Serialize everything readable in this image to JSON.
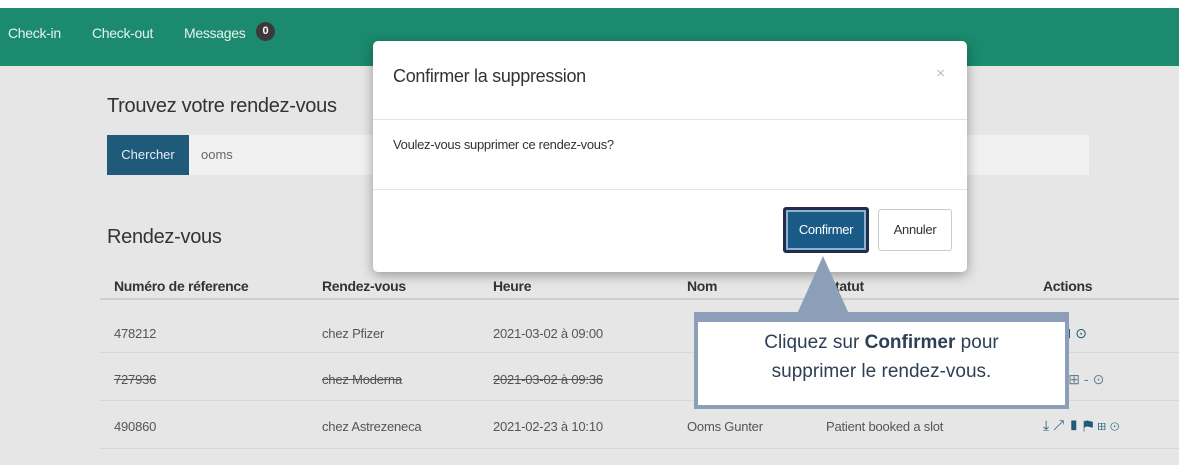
{
  "nav": {
    "checkin": "Check-in",
    "checkout": "Check-out",
    "messages": "Messages",
    "messages_count": "0"
  },
  "search": {
    "title": "Trouvez votre rendez-vous",
    "button": "Chercher",
    "value": "ooms"
  },
  "appointments": {
    "title": "Rendez-vous",
    "columns": [
      "Numéro de réference",
      "Rendez-vous",
      "Heure",
      "Nom",
      "Statut",
      "Actions"
    ],
    "rows": [
      {
        "ref": "478212",
        "rdv": "chez Pfizer",
        "heure": "2021-03-02 à 09:00",
        "nom": "",
        "statut": "",
        "cancelled": false
      },
      {
        "ref": "727936",
        "rdv": "chez Moderna",
        "heure": "2021-03-02 à 09:36",
        "nom": "",
        "statut": "",
        "cancelled": true
      },
      {
        "ref": "490860",
        "rdv": "chez Astrezeneca",
        "heure": "2021-02-23 à 10:10",
        "nom": "Ooms Gunter",
        "statut": "Patient booked a slot",
        "cancelled": false
      }
    ]
  },
  "modal": {
    "title": "Confirmer la suppression",
    "close": "×",
    "body": "Voulez-vous supprimer ce rendez-vous?",
    "confirm": "Confirmer",
    "cancel": "Annuler"
  },
  "callout": {
    "line1_prefix": "Cliquez sur ",
    "line1_bold": "Confirmer",
    "line1_suffix": " pour",
    "line2": "supprimer le rendez-vous."
  },
  "icons": [
    "download-icon",
    "external-link-icon",
    "trash-icon",
    "flag-icon",
    "edit-icon",
    "cancel-icon"
  ],
  "colors": {
    "nav": "#1b8a6e",
    "primary": "#1a5a86",
    "callout_border": "#8d9fb8"
  }
}
